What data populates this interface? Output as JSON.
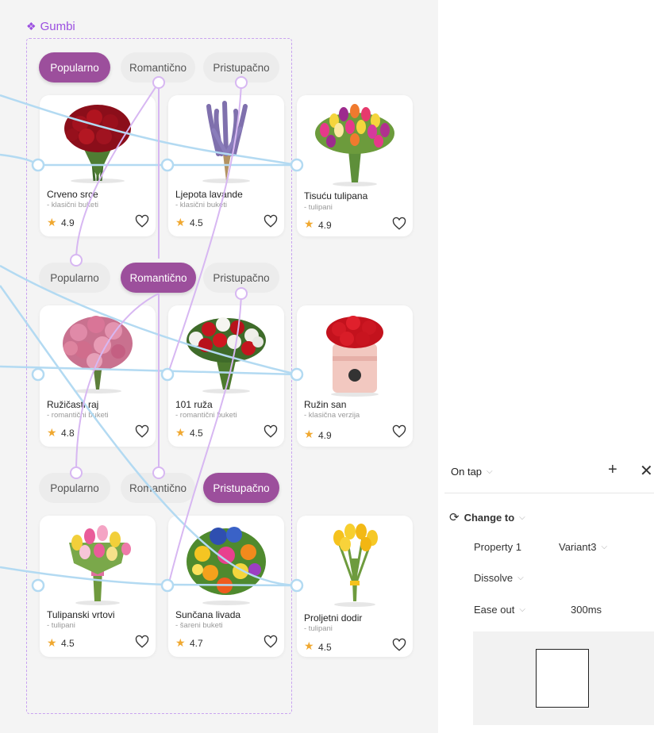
{
  "component": {
    "name": "Gumbi",
    "icon": "component-diamond-icon"
  },
  "variants": [
    {
      "tabs": [
        {
          "label": "Popularno",
          "active": true
        },
        {
          "label": "Romantično",
          "active": false
        },
        {
          "label": "Pristupačno",
          "active": false
        }
      ],
      "cards": [
        {
          "name": "Crveno srce",
          "category": "- klasični buketi",
          "rating": "4.9",
          "flower": "red-roses"
        },
        {
          "name": "Ljepota lavande",
          "category": "- klasični buketi",
          "rating": "4.5",
          "flower": "lavender"
        },
        {
          "name": "Tisuću tulipana",
          "category": "- tulipani",
          "rating": "4.9",
          "flower": "mixed-tulips"
        }
      ]
    },
    {
      "tabs": [
        {
          "label": "Popularno",
          "active": false
        },
        {
          "label": "Romantično",
          "active": true
        },
        {
          "label": "Pristupačno",
          "active": false
        }
      ],
      "cards": [
        {
          "name": "Ružičasti raj",
          "category": "- romantični buketi",
          "rating": "4.8",
          "flower": "pink-roses"
        },
        {
          "name": "101 ruža",
          "category": "- romantični buketi",
          "rating": "4.5",
          "flower": "red-white-roses"
        },
        {
          "name": "Ružin san",
          "category": "- klasična verzija",
          "rating": "4.9",
          "flower": "rose-box"
        }
      ]
    },
    {
      "tabs": [
        {
          "label": "Popularno",
          "active": false
        },
        {
          "label": "Romantično",
          "active": false
        },
        {
          "label": "Pristupačno",
          "active": true
        }
      ],
      "cards": [
        {
          "name": "Tulipanski vrtovi",
          "category": "- tulipani",
          "rating": "4.5",
          "flower": "tulip-bouquet"
        },
        {
          "name": "Sunčana livada",
          "category": "- šareni buketi",
          "rating": "4.7",
          "flower": "colorful-meadow"
        },
        {
          "name": "Proljetni dodir",
          "category": "- tulipani",
          "rating": "4.5",
          "flower": "yellow-tulips"
        }
      ]
    }
  ],
  "interaction": {
    "trigger": "On tap",
    "action": "Change to",
    "property_label": "Property 1",
    "property_value": "Variant3",
    "animation": "Dissolve",
    "easing": "Ease out",
    "duration": "300ms"
  },
  "colors": {
    "accent": "#9c4f9c",
    "wire_purple": "#d7b7f2",
    "wire_blue": "#b3daf2",
    "component_purple": "#9b4fe0"
  }
}
